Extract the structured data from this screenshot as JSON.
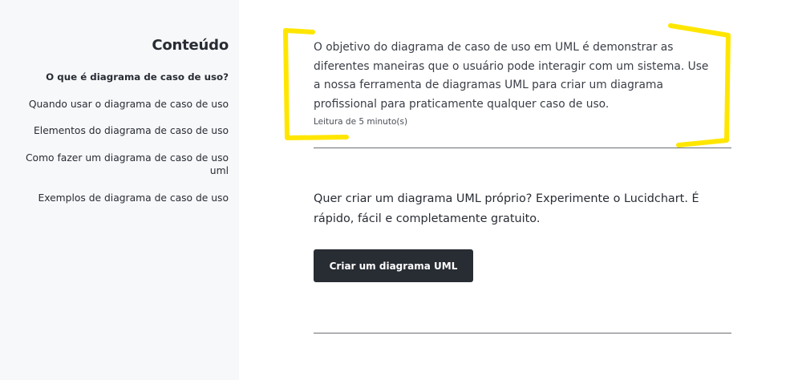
{
  "sidebar": {
    "title": "Conteúdo",
    "items": [
      {
        "label": "O que é diagrama de caso de uso?",
        "active": true
      },
      {
        "label": "Quando usar o diagrama de caso de uso",
        "active": false
      },
      {
        "label": "Elementos do diagrama de caso de uso",
        "active": false
      },
      {
        "label": "Como fazer um diagrama de caso de uso uml",
        "active": false
      },
      {
        "label": "Exemplos de diagrama de caso de uso",
        "active": false
      }
    ]
  },
  "main": {
    "intro": "O objetivo do diagrama de caso de uso em UML é demonstrar as diferentes maneiras que o usuário pode interagir com um sistema. Use a nossa ferramenta de diagramas UML para criar um diagrama profissional para praticamente qualquer caso de uso.",
    "read_time": "Leitura de 5 minuto(s)",
    "cta_text": "Quer criar um diagrama UML próprio? Experimente o Lucidchart. É rápido, fácil e completamente gratuito.",
    "cta_button": "Criar um diagrama UML"
  },
  "colors": {
    "sidebar_bg": "#f7f8fa",
    "text": "#282c33",
    "button_bg": "#282c33",
    "button_text": "#ffffff",
    "highlight": "#ffe600"
  }
}
